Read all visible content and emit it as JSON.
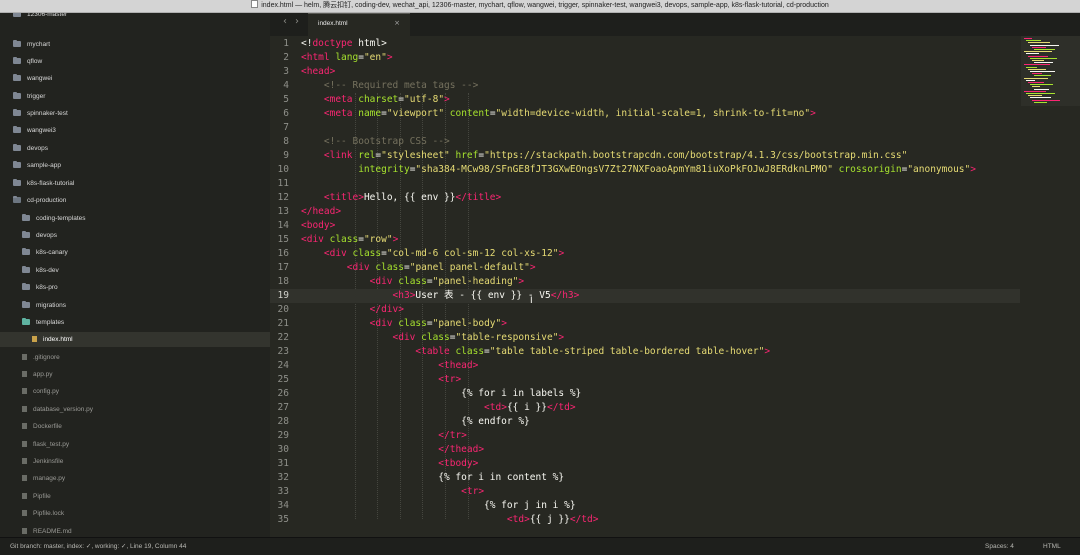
{
  "window": {
    "title": "index.html — helm, 腾云扣钉, coding-dev, wechat_api, 12306-master, mychart, qflow, wangwei, trigger, spinnaker-test, wangwei3, devops, sample-app, k8s-flask-tutorial, cd-production"
  },
  "sidebar": {
    "items": [
      {
        "label": "12306-master",
        "kind": "folder"
      },
      {
        "label": "mychart",
        "kind": "folder"
      },
      {
        "label": "qflow",
        "kind": "folder"
      },
      {
        "label": "wangwei",
        "kind": "folder"
      },
      {
        "label": "trigger",
        "kind": "folder"
      },
      {
        "label": "spinnaker-test",
        "kind": "folder"
      },
      {
        "label": "wangwei3",
        "kind": "folder"
      },
      {
        "label": "devops",
        "kind": "folder"
      },
      {
        "label": "sample-app",
        "kind": "folder"
      },
      {
        "label": "k8s-flask-tutorial",
        "kind": "folder"
      },
      {
        "label": "cd-production",
        "kind": "folder"
      },
      {
        "label": "coding-templates",
        "kind": "folder"
      },
      {
        "label": "devops",
        "kind": "folder"
      },
      {
        "label": "k8s-canary",
        "kind": "folder"
      },
      {
        "label": "k8s-dev",
        "kind": "folder"
      },
      {
        "label": "k8s-pro",
        "kind": "folder"
      },
      {
        "label": "migrations",
        "kind": "folder"
      },
      {
        "label": "templates",
        "kind": "folder"
      },
      {
        "label": "index.html",
        "kind": "file"
      },
      {
        "label": ".gitignore",
        "kind": "file"
      },
      {
        "label": "app.py",
        "kind": "file"
      },
      {
        "label": "config.py",
        "kind": "file"
      },
      {
        "label": "database_version.py",
        "kind": "file"
      },
      {
        "label": "Dockerfile",
        "kind": "file"
      },
      {
        "label": "flask_test.py",
        "kind": "file"
      },
      {
        "label": "Jenkinsfile",
        "kind": "file"
      },
      {
        "label": "manage.py",
        "kind": "file"
      },
      {
        "label": "Pipfile",
        "kind": "file"
      },
      {
        "label": "Pipfile.lock",
        "kind": "file"
      },
      {
        "label": "README.md",
        "kind": "file"
      }
    ]
  },
  "tabs": {
    "back_icon": "‹",
    "forward_icon": "›",
    "active": {
      "label": "index.html",
      "close_icon": "×"
    }
  },
  "editor": {
    "current_line": 19,
    "lines": [
      {
        "n": "1",
        "tokens": [
          [
            "t",
            "<!"
          ],
          [
            "g",
            "doctype"
          ],
          [
            "t",
            " html>"
          ]
        ]
      },
      {
        "n": "2",
        "tokens": [
          [
            "g",
            "<html"
          ],
          [
            "a",
            " lang"
          ],
          [
            "t",
            "="
          ],
          [
            "s",
            "\"en\""
          ],
          [
            "g",
            ">"
          ]
        ]
      },
      {
        "n": "3",
        "tokens": [
          [
            "g",
            "<head"
          ],
          [
            "g",
            ">"
          ]
        ]
      },
      {
        "n": "4",
        "tokens": [
          [
            "t",
            "    "
          ],
          [
            "c",
            "<!-- Required meta tags -->"
          ]
        ]
      },
      {
        "n": "5",
        "tokens": [
          [
            "t",
            "    "
          ],
          [
            "g",
            "<meta"
          ],
          [
            "a",
            " charset"
          ],
          [
            "t",
            "="
          ],
          [
            "s",
            "\"utf-8\""
          ],
          [
            "g",
            ">"
          ]
        ]
      },
      {
        "n": "6",
        "tokens": [
          [
            "t",
            "    "
          ],
          [
            "g",
            "<meta"
          ],
          [
            "a",
            " name"
          ],
          [
            "t",
            "="
          ],
          [
            "s",
            "\"viewport\""
          ],
          [
            "a",
            " content"
          ],
          [
            "t",
            "="
          ],
          [
            "s",
            "\"width=device-width, initial-scale=1, shrink-to-fit=no\""
          ],
          [
            "g",
            ">"
          ]
        ]
      },
      {
        "n": "7",
        "tokens": []
      },
      {
        "n": "8",
        "tokens": [
          [
            "t",
            "    "
          ],
          [
            "c",
            "<!-- Bootstrap CSS -->"
          ]
        ]
      },
      {
        "n": "9",
        "tokens": [
          [
            "t",
            "    "
          ],
          [
            "g",
            "<link"
          ],
          [
            "a",
            " rel"
          ],
          [
            "t",
            "="
          ],
          [
            "s",
            "\"stylesheet\""
          ],
          [
            "a",
            " href"
          ],
          [
            "t",
            "="
          ],
          [
            "s",
            "\"https://stackpath.bootstrapcdn.com/bootstrap/4.1.3/css/bootstrap.min.css\""
          ]
        ]
      },
      {
        "n": "10",
        "tokens": [
          [
            "t",
            "          "
          ],
          [
            "a",
            "integrity"
          ],
          [
            "t",
            "="
          ],
          [
            "s",
            "\"sha384-MCw98/SFnGE8fJT3GXwEOngsV7Zt27NXFoaoApmYm81iuXoPkFOJwJ8ERdknLPMO\""
          ],
          [
            "a",
            " crossorigin"
          ],
          [
            "t",
            "="
          ],
          [
            "s",
            "\"anonymous\""
          ],
          [
            "g",
            ">"
          ]
        ]
      },
      {
        "n": "11",
        "tokens": []
      },
      {
        "n": "12",
        "tokens": [
          [
            "t",
            "    "
          ],
          [
            "g",
            "<title"
          ],
          [
            "g",
            ">"
          ],
          [
            "t",
            "Hello, {{ env }}"
          ],
          [
            "g",
            "</title"
          ],
          [
            "g",
            ">"
          ]
        ]
      },
      {
        "n": "13",
        "tokens": [
          [
            "g",
            "</head"
          ],
          [
            "g",
            ">"
          ]
        ]
      },
      {
        "n": "14",
        "tokens": [
          [
            "g",
            "<body"
          ],
          [
            "g",
            ">"
          ]
        ]
      },
      {
        "n": "15",
        "tokens": [
          [
            "g",
            "<div"
          ],
          [
            "a",
            " class"
          ],
          [
            "t",
            "="
          ],
          [
            "s",
            "\"row\""
          ],
          [
            "g",
            ">"
          ]
        ]
      },
      {
        "n": "16",
        "tokens": [
          [
            "t",
            "    "
          ],
          [
            "g",
            "<div"
          ],
          [
            "a",
            " class"
          ],
          [
            "t",
            "="
          ],
          [
            "s",
            "\"col-md-6 col-sm-12 col-xs-12\""
          ],
          [
            "g",
            ">"
          ]
        ]
      },
      {
        "n": "17",
        "tokens": [
          [
            "t",
            "        "
          ],
          [
            "g",
            "<div"
          ],
          [
            "a",
            " class"
          ],
          [
            "t",
            "="
          ],
          [
            "s",
            "\"panel panel-default\""
          ],
          [
            "g",
            ">"
          ]
        ]
      },
      {
        "n": "18",
        "tokens": [
          [
            "t",
            "            "
          ],
          [
            "g",
            "<div"
          ],
          [
            "a",
            " class"
          ],
          [
            "t",
            "="
          ],
          [
            "s",
            "\"panel-heading\""
          ],
          [
            "g",
            ">"
          ]
        ]
      },
      {
        "n": "19",
        "tokens": [
          [
            "t",
            "                "
          ],
          [
            "g",
            "<h3"
          ],
          [
            "g",
            ">"
          ],
          [
            "t",
            "User 表 - {{ env }} - V5"
          ],
          [
            "g",
            "</h3"
          ],
          [
            "g",
            ">"
          ]
        ]
      },
      {
        "n": "20",
        "tokens": [
          [
            "t",
            "            "
          ],
          [
            "g",
            "</div"
          ],
          [
            "g",
            ">"
          ]
        ]
      },
      {
        "n": "21",
        "tokens": [
          [
            "t",
            "            "
          ],
          [
            "g",
            "<div"
          ],
          [
            "a",
            " class"
          ],
          [
            "t",
            "="
          ],
          [
            "s",
            "\"panel-body\""
          ],
          [
            "g",
            ">"
          ]
        ]
      },
      {
        "n": "22",
        "tokens": [
          [
            "t",
            "                "
          ],
          [
            "g",
            "<div"
          ],
          [
            "a",
            " class"
          ],
          [
            "t",
            "="
          ],
          [
            "s",
            "\"table-responsive\""
          ],
          [
            "g",
            ">"
          ]
        ]
      },
      {
        "n": "23",
        "tokens": [
          [
            "t",
            "                    "
          ],
          [
            "g",
            "<table"
          ],
          [
            "a",
            " class"
          ],
          [
            "t",
            "="
          ],
          [
            "s",
            "\"table table-striped table-bordered table-hover\""
          ],
          [
            "g",
            ">"
          ]
        ]
      },
      {
        "n": "24",
        "tokens": [
          [
            "t",
            "                        "
          ],
          [
            "g",
            "<thead"
          ],
          [
            "g",
            ">"
          ]
        ]
      },
      {
        "n": "25",
        "tokens": [
          [
            "t",
            "                        "
          ],
          [
            "g",
            "<tr"
          ],
          [
            "g",
            ">"
          ]
        ]
      },
      {
        "n": "26",
        "tokens": [
          [
            "t",
            "                            {% for i in labels %}"
          ]
        ]
      },
      {
        "n": "27",
        "tokens": [
          [
            "t",
            "                                "
          ],
          [
            "g",
            "<td"
          ],
          [
            "g",
            ">"
          ],
          [
            "t",
            "{{ i }}"
          ],
          [
            "g",
            "</td"
          ],
          [
            "g",
            ">"
          ]
        ]
      },
      {
        "n": "28",
        "tokens": [
          [
            "t",
            "                            {% endfor %}"
          ]
        ]
      },
      {
        "n": "29",
        "tokens": [
          [
            "t",
            "                        "
          ],
          [
            "g",
            "</tr"
          ],
          [
            "g",
            ">"
          ]
        ]
      },
      {
        "n": "30",
        "tokens": [
          [
            "t",
            "                        "
          ],
          [
            "g",
            "</thead"
          ],
          [
            "g",
            ">"
          ]
        ]
      },
      {
        "n": "31",
        "tokens": [
          [
            "t",
            "                        "
          ],
          [
            "g",
            "<tbody"
          ],
          [
            "g",
            ">"
          ]
        ]
      },
      {
        "n": "32",
        "tokens": [
          [
            "t",
            "                        {% for i in content %}"
          ]
        ]
      },
      {
        "n": "33",
        "tokens": [
          [
            "t",
            "                            "
          ],
          [
            "g",
            "<tr"
          ],
          [
            "g",
            ">"
          ]
        ]
      },
      {
        "n": "34",
        "tokens": [
          [
            "t",
            "                                {% for j in i %}"
          ]
        ]
      },
      {
        "n": "35",
        "tokens": [
          [
            "t",
            "                                    "
          ],
          [
            "g",
            "<td"
          ],
          [
            "g",
            ">"
          ],
          [
            "t",
            "{{ j }}"
          ],
          [
            "g",
            "</td"
          ],
          [
            "g",
            ">"
          ]
        ]
      }
    ]
  },
  "statusbar": {
    "left": "Git branch: master, index: ✓, working: ✓, Line 19, Column 44",
    "spaces": "Spaces: 4",
    "syntax": "HTML"
  },
  "colors": {
    "background": "#272822",
    "tag": "#f92672",
    "attribute": "#a6e22e",
    "string": "#e6db74",
    "comment": "#75715e",
    "text": "#f8f8f2"
  }
}
